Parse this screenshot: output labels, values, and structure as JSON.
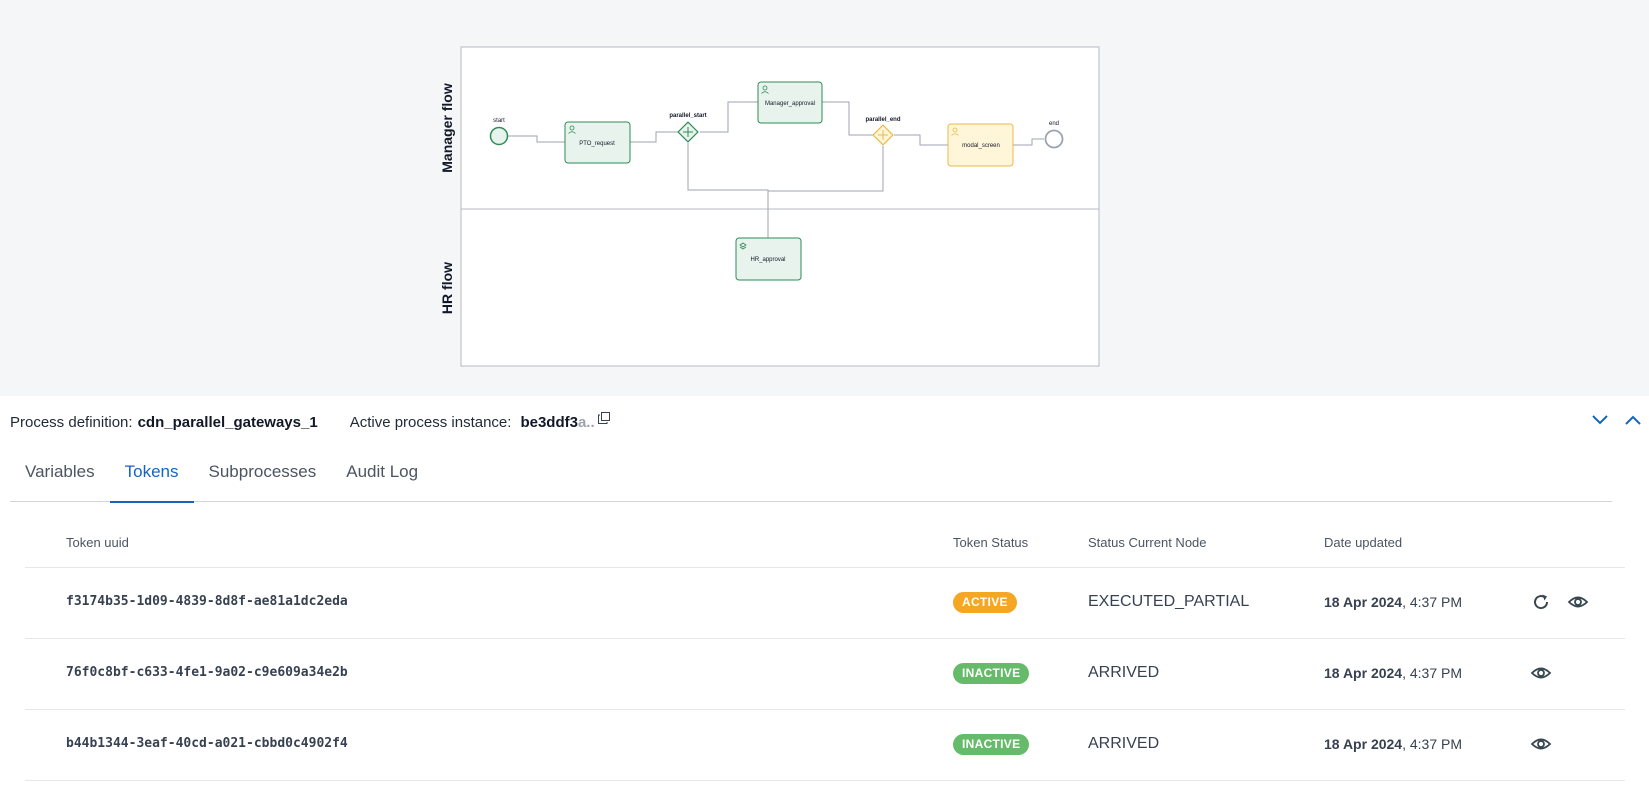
{
  "diagram": {
    "lanes": [
      "Manager flow",
      "HR flow"
    ],
    "nodes": {
      "start": "start",
      "pto_request": "PTO_request",
      "parallel_start": "parallel_start",
      "manager_approval": "Manager_approval",
      "parallel_end": "parallel_end",
      "modal_screen": "modal_screen",
      "end": "end",
      "hr_approval": "HR_approval"
    },
    "colors": {
      "task_stroke": "#2e8b57",
      "task_fill": "#e8f3ee",
      "active_stroke": "#e9b949",
      "active_fill": "#fff6d9"
    }
  },
  "info": {
    "process_definition_label": "Process definition:",
    "process_definition_value": "cdn_parallel_gateways_1",
    "active_instance_label": "Active process instance:",
    "active_instance_value": "be3ddf3",
    "active_instance_fade": "a..",
    "copy_icon": "copy-icon",
    "collapse_icon": "chevron-down-icon",
    "expand_icon": "chevron-up-icon"
  },
  "tabs": [
    {
      "label": "Variables",
      "active": false
    },
    {
      "label": "Tokens",
      "active": true
    },
    {
      "label": "Subprocesses",
      "active": false
    },
    {
      "label": "Audit Log",
      "active": false
    }
  ],
  "table": {
    "headers": {
      "uuid": "Token uuid",
      "status": "Token Status",
      "node": "Status Current Node",
      "date": "Date updated"
    },
    "rows": [
      {
        "uuid": "f3174b35-1d09-4839-8d8f-ae81a1dc2eda",
        "status": "ACTIVE",
        "node": "EXECUTED_PARTIAL",
        "date_bold": "18 Apr 2024",
        "date_rest": ", 4:37 PM",
        "icons": [
          "refresh-icon",
          "eye-icon"
        ]
      },
      {
        "uuid": "76f0c8bf-c633-4fe1-9a02-c9e609a34e2b",
        "status": "INACTIVE",
        "node": "ARRIVED",
        "date_bold": "18 Apr 2024",
        "date_rest": ", 4:37 PM",
        "icons": [
          "eye-icon"
        ]
      },
      {
        "uuid": "b44b1344-3eaf-40cd-a021-cbbd0c4902f4",
        "status": "INACTIVE",
        "node": "ARRIVED",
        "date_bold": "18 Apr 2024",
        "date_rest": ", 4:37 PM",
        "icons": [
          "eye-icon"
        ]
      }
    ],
    "status_colors": {
      "ACTIVE": "#f5a623",
      "INACTIVE": "#66bb6a"
    }
  }
}
